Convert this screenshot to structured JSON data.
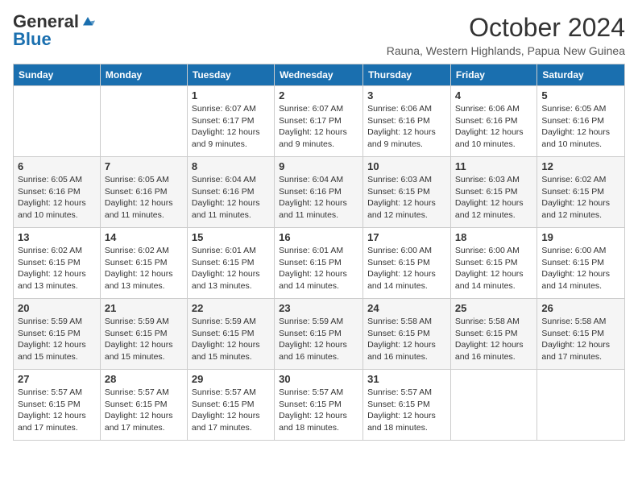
{
  "logo": {
    "general": "General",
    "blue": "Blue"
  },
  "title": "October 2024",
  "location": "Rauna, Western Highlands, Papua New Guinea",
  "weekdays": [
    "Sunday",
    "Monday",
    "Tuesday",
    "Wednesday",
    "Thursday",
    "Friday",
    "Saturday"
  ],
  "weeks": [
    [
      {
        "day": "",
        "info": ""
      },
      {
        "day": "",
        "info": ""
      },
      {
        "day": "1",
        "info": "Sunrise: 6:07 AM\nSunset: 6:17 PM\nDaylight: 12 hours and 9 minutes."
      },
      {
        "day": "2",
        "info": "Sunrise: 6:07 AM\nSunset: 6:17 PM\nDaylight: 12 hours and 9 minutes."
      },
      {
        "day": "3",
        "info": "Sunrise: 6:06 AM\nSunset: 6:16 PM\nDaylight: 12 hours and 9 minutes."
      },
      {
        "day": "4",
        "info": "Sunrise: 6:06 AM\nSunset: 6:16 PM\nDaylight: 12 hours and 10 minutes."
      },
      {
        "day": "5",
        "info": "Sunrise: 6:05 AM\nSunset: 6:16 PM\nDaylight: 12 hours and 10 minutes."
      }
    ],
    [
      {
        "day": "6",
        "info": "Sunrise: 6:05 AM\nSunset: 6:16 PM\nDaylight: 12 hours and 10 minutes."
      },
      {
        "day": "7",
        "info": "Sunrise: 6:05 AM\nSunset: 6:16 PM\nDaylight: 12 hours and 11 minutes."
      },
      {
        "day": "8",
        "info": "Sunrise: 6:04 AM\nSunset: 6:16 PM\nDaylight: 12 hours and 11 minutes."
      },
      {
        "day": "9",
        "info": "Sunrise: 6:04 AM\nSunset: 6:16 PM\nDaylight: 12 hours and 11 minutes."
      },
      {
        "day": "10",
        "info": "Sunrise: 6:03 AM\nSunset: 6:15 PM\nDaylight: 12 hours and 12 minutes."
      },
      {
        "day": "11",
        "info": "Sunrise: 6:03 AM\nSunset: 6:15 PM\nDaylight: 12 hours and 12 minutes."
      },
      {
        "day": "12",
        "info": "Sunrise: 6:02 AM\nSunset: 6:15 PM\nDaylight: 12 hours and 12 minutes."
      }
    ],
    [
      {
        "day": "13",
        "info": "Sunrise: 6:02 AM\nSunset: 6:15 PM\nDaylight: 12 hours and 13 minutes."
      },
      {
        "day": "14",
        "info": "Sunrise: 6:02 AM\nSunset: 6:15 PM\nDaylight: 12 hours and 13 minutes."
      },
      {
        "day": "15",
        "info": "Sunrise: 6:01 AM\nSunset: 6:15 PM\nDaylight: 12 hours and 13 minutes."
      },
      {
        "day": "16",
        "info": "Sunrise: 6:01 AM\nSunset: 6:15 PM\nDaylight: 12 hours and 14 minutes."
      },
      {
        "day": "17",
        "info": "Sunrise: 6:00 AM\nSunset: 6:15 PM\nDaylight: 12 hours and 14 minutes."
      },
      {
        "day": "18",
        "info": "Sunrise: 6:00 AM\nSunset: 6:15 PM\nDaylight: 12 hours and 14 minutes."
      },
      {
        "day": "19",
        "info": "Sunrise: 6:00 AM\nSunset: 6:15 PM\nDaylight: 12 hours and 14 minutes."
      }
    ],
    [
      {
        "day": "20",
        "info": "Sunrise: 5:59 AM\nSunset: 6:15 PM\nDaylight: 12 hours and 15 minutes."
      },
      {
        "day": "21",
        "info": "Sunrise: 5:59 AM\nSunset: 6:15 PM\nDaylight: 12 hours and 15 minutes."
      },
      {
        "day": "22",
        "info": "Sunrise: 5:59 AM\nSunset: 6:15 PM\nDaylight: 12 hours and 15 minutes."
      },
      {
        "day": "23",
        "info": "Sunrise: 5:59 AM\nSunset: 6:15 PM\nDaylight: 12 hours and 16 minutes."
      },
      {
        "day": "24",
        "info": "Sunrise: 5:58 AM\nSunset: 6:15 PM\nDaylight: 12 hours and 16 minutes."
      },
      {
        "day": "25",
        "info": "Sunrise: 5:58 AM\nSunset: 6:15 PM\nDaylight: 12 hours and 16 minutes."
      },
      {
        "day": "26",
        "info": "Sunrise: 5:58 AM\nSunset: 6:15 PM\nDaylight: 12 hours and 17 minutes."
      }
    ],
    [
      {
        "day": "27",
        "info": "Sunrise: 5:57 AM\nSunset: 6:15 PM\nDaylight: 12 hours and 17 minutes."
      },
      {
        "day": "28",
        "info": "Sunrise: 5:57 AM\nSunset: 6:15 PM\nDaylight: 12 hours and 17 minutes."
      },
      {
        "day": "29",
        "info": "Sunrise: 5:57 AM\nSunset: 6:15 PM\nDaylight: 12 hours and 17 minutes."
      },
      {
        "day": "30",
        "info": "Sunrise: 5:57 AM\nSunset: 6:15 PM\nDaylight: 12 hours and 18 minutes."
      },
      {
        "day": "31",
        "info": "Sunrise: 5:57 AM\nSunset: 6:15 PM\nDaylight: 12 hours and 18 minutes."
      },
      {
        "day": "",
        "info": ""
      },
      {
        "day": "",
        "info": ""
      }
    ]
  ]
}
